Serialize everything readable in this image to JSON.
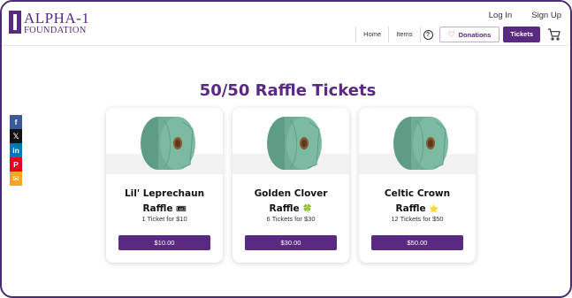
{
  "brand": {
    "line1": "ALPHA-1",
    "line2": "FOUNDATION"
  },
  "top_links": {
    "login": "Log In",
    "signup": "Sign Up"
  },
  "nav": {
    "home": "Home",
    "items": "Items",
    "help_symbol": "?",
    "donations": "Donations",
    "tickets": "Tickets",
    "heart_icon": "heart-icon",
    "cart_icon": "cart-icon"
  },
  "social": [
    {
      "name": "facebook-icon",
      "glyph": "f"
    },
    {
      "name": "x-icon",
      "glyph": "𝕏"
    },
    {
      "name": "linkedin-icon",
      "glyph": "in"
    },
    {
      "name": "pinterest-icon",
      "glyph": "P"
    },
    {
      "name": "email-icon",
      "glyph": "✉"
    }
  ],
  "page_title": "50/50 Raffle Tickets",
  "cards": [
    {
      "title_line1": "Lil' Leprechaun",
      "title_line2": "Raffle",
      "emoji": "🎟",
      "subtitle": "1 Ticket for $10",
      "button": "$10.00"
    },
    {
      "title_line1": "Golden Clover",
      "title_line2": "Raffle",
      "emoji": "🍀",
      "subtitle": "6 Tickets for $30",
      "button": "$30.00"
    },
    {
      "title_line1": "Celtic Crown",
      "title_line2": "Raffle",
      "emoji": "⭐",
      "subtitle": "12 Tickets for $50",
      "button": "$50.00"
    }
  ],
  "colors": {
    "brand_purple": "#5a2a82",
    "ticket_green": "#6fae95",
    "frame": "#4a2a73"
  }
}
